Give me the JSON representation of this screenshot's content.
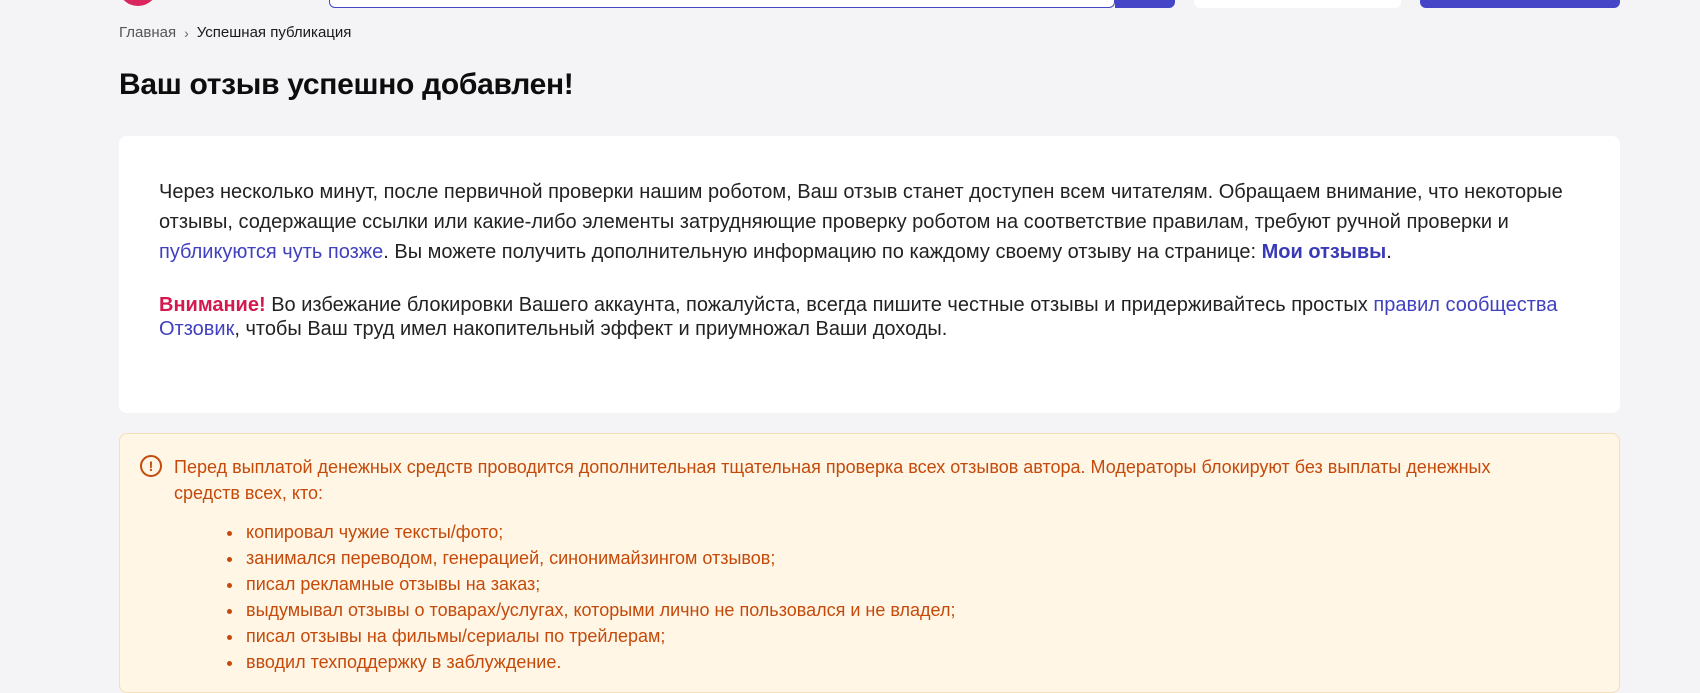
{
  "header": {
    "logo_icon": "brand-logo-icon"
  },
  "breadcrumb": {
    "home": "Главная",
    "separator": "›",
    "current": "Успешная публикация"
  },
  "page_title": "Ваш отзыв успешно добавлен!",
  "info": {
    "p1_text_a": "Через несколько минут, после первичной проверки нашим роботом, Ваш отзыв станет доступен всем читателям. Обращаем внимание, что некоторые отзывы, содержащие ссылки или какие-либо элементы затрудняющие проверку роботом на соответствие правилам, требуют ручной проверки и ",
    "p1_link": "публикуются чуть позже",
    "p1_text_b": ". Вы можете получить дополнительную информацию по каждому своему отзыву на странице: ",
    "my_reviews_link": "Мои отзывы",
    "p1_end": ".",
    "warning_word": "Внимание!",
    "p2_text_a": " Во избежание блокировки Вашего аккаунта, пожалуйста, всегда пишите честные отзывы и придерживайтесь простых ",
    "p2_link": "правил сообщества Отзовик",
    "p2_text_b": ", чтобы Ваш труд имел накопительный эффект и приумножал Ваши доходы."
  },
  "notice": {
    "icon": "exclamation-circle-icon",
    "icon_glyph": "!",
    "text": "Перед выплатой денежных средств проводится дополнительная тщательная проверка всех отзывов автора. Модераторы блокируют без выплаты денежных средств всех, кто:",
    "items": [
      "копировал чужие тексты/фото;",
      "занимался переводом, генерацией, синонимайзингом отзывов;",
      "писал рекламные отзывы на заказ;",
      "выдумывал отзывы о товарах/услугах, которыми лично не пользовался и не владел;",
      "писал отзывы на фильмы/сериалы по трейлерам;",
      "вводил техподдержку в заблуждение."
    ]
  },
  "colors": {
    "accent": "#4545c8",
    "brand": "#d9265e",
    "warning_text": "#c54a0a",
    "warning_bg": "#fff6e6"
  }
}
